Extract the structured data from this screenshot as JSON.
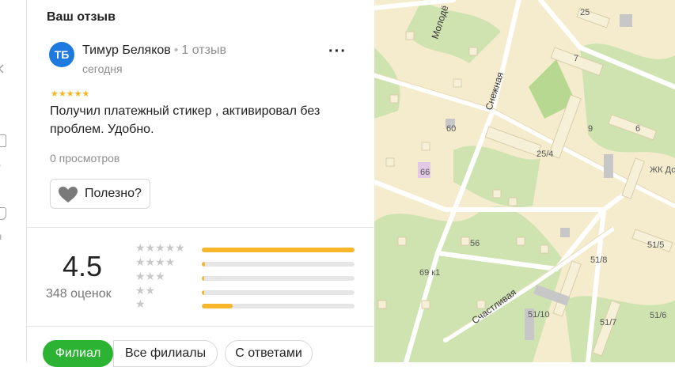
{
  "rail": {
    "items": [
      {
        "label": "ья",
        "icon": "marker-icon"
      },
      {
        "label": "д",
        "icon": "route-icon"
      },
      {
        "label": "ьё",
        "icon": "house-icon"
      },
      {
        "label": "ты",
        "icon": "tag-icon"
      }
    ]
  },
  "review": {
    "section_title": "Ваш отзыв",
    "avatar_initials": "ТБ",
    "author": "Тимур Беляков",
    "author_reviews": "1 отзыв",
    "date": "сегодня",
    "stars": "★★★★★",
    "text": "Получил платежный стикер , активировал без проблем. Удобно.",
    "views": "0 просмотров",
    "useful_label": "Полезно?"
  },
  "rating": {
    "value": "4.5",
    "count": "348 оценок",
    "distribution": [
      {
        "stars": "★★★★★",
        "fraction": 1.0
      },
      {
        "stars": "★★★★",
        "fraction": 0.02
      },
      {
        "stars": "★★★",
        "fraction": 0.015
      },
      {
        "stars": "★★",
        "fraction": 0.015
      },
      {
        "stars": "★",
        "fraction": 0.2
      }
    ]
  },
  "filters": [
    {
      "label": "Филиал",
      "active": true
    },
    {
      "label": "Все филиалы",
      "active": false
    },
    {
      "label": "С ответами",
      "active": false
    }
  ],
  "map": {
    "streets": [
      "Молодё",
      "Снежная",
      "Счастливая"
    ],
    "house_numbers": [
      "25",
      "7",
      "9",
      "6",
      "60",
      "66",
      "25/4",
      "56",
      "69 к1",
      "51/8",
      "51/5",
      "51/10",
      "51/7",
      "51/6"
    ],
    "complex_label": "ЖК До"
  },
  "colors": {
    "accent_green": "#2db334",
    "avatar_blue": "#1f7ae0",
    "star_yellow": "#f5b61a"
  }
}
